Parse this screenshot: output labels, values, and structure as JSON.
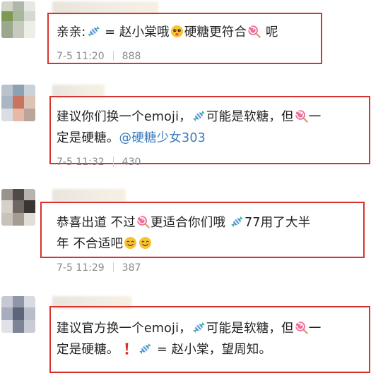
{
  "comments": [
    {
      "lines": [
        [
          {
            "t": "亲亲:"
          },
          {
            "icon": "candy-icon"
          },
          {
            "t": " = 赵小棠哦"
          },
          {
            "icon": "pleading-face-icon"
          },
          {
            "t": "硬糖更符合"
          },
          {
            "icon": "lollipop-icon"
          },
          {
            "t": " 呢"
          }
        ]
      ],
      "date": "7-5 11:20",
      "likes": "888"
    },
    {
      "lines": [
        [
          {
            "t": "建议你们换一个emoji，"
          },
          {
            "icon": "candy-icon"
          },
          {
            "t": "可能是软糖，但"
          },
          {
            "icon": "lollipop-icon"
          },
          {
            "t": "一"
          }
        ],
        [
          {
            "t": "定是硬糖。"
          },
          {
            "t": "@硬糖少女303",
            "mention": true
          }
        ]
      ],
      "date": "7-5 11:32",
      "likes": "430"
    },
    {
      "lines": [
        [
          {
            "t": "恭喜出道  不过"
          },
          {
            "icon": "lollipop-icon"
          },
          {
            "t": "更适合你们哦 "
          },
          {
            "icon": "candy-icon"
          },
          {
            "t": "77用了大半"
          }
        ],
        [
          {
            "t": "年 不合适吧"
          },
          {
            "icon": "smiling-face-icon"
          },
          {
            "icon": "smiling-face-icon"
          }
        ]
      ],
      "date": "7-5 11:29",
      "likes": "387"
    },
    {
      "lines": [
        [
          {
            "t": "建议官方换一个emoji，"
          },
          {
            "icon": "candy-icon"
          },
          {
            "t": "可能是软糖，但"
          },
          {
            "icon": "lollipop-icon"
          },
          {
            "t": "一"
          }
        ],
        [
          {
            "t": "定是硬糖。"
          },
          {
            "icon": "exclamation-icon"
          },
          {
            "t": " "
          },
          {
            "icon": "candy-icon"
          },
          {
            "t": " = 赵小棠，望周知。"
          }
        ]
      ]
    }
  ],
  "colors": {
    "highlight_border": "#d9322e",
    "mention": "#3a7bbf",
    "meta": "#8a8a8a"
  }
}
